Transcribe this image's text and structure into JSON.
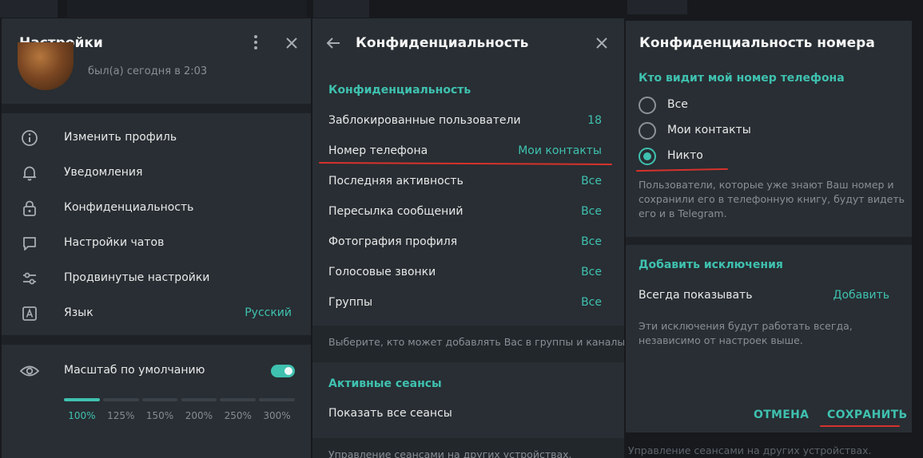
{
  "settings": {
    "title": "Настройки",
    "status": "был(а) сегодня в 2:03",
    "menu": [
      {
        "label": "Изменить профиль",
        "icon": "info-icon"
      },
      {
        "label": "Уведомления",
        "icon": "bell-icon"
      },
      {
        "label": "Конфиденциальность",
        "icon": "lock-icon"
      },
      {
        "label": "Настройки чатов",
        "icon": "chat-bubble-icon"
      },
      {
        "label": "Продвинутые настройки",
        "icon": "sliders-icon"
      },
      {
        "label": "Язык",
        "icon": "language-icon",
        "value": "Русский"
      }
    ],
    "scale": {
      "label": "Масштаб по умолчанию",
      "enabled": true,
      "options": [
        "100%",
        "125%",
        "150%",
        "200%",
        "250%",
        "300%"
      ],
      "selected_index": 0
    }
  },
  "privacy": {
    "title": "Конфиденциальность",
    "section_title": "Конфиденциальность",
    "rows": [
      {
        "label": "Заблокированные пользователи",
        "value": "18"
      },
      {
        "label": "Номер телефона",
        "value": "Мои контакты"
      },
      {
        "label": "Последняя активность",
        "value": "Все"
      },
      {
        "label": "Пересылка сообщений",
        "value": "Все"
      },
      {
        "label": "Фотография профиля",
        "value": "Все"
      },
      {
        "label": "Голосовые звонки",
        "value": "Все"
      },
      {
        "label": "Группы",
        "value": "Все"
      }
    ],
    "groups_hint": "Выберите, кто может добавлять Вас в группы и каналы.",
    "sessions_title": "Активные сеансы",
    "sessions_row": "Показать все сеансы",
    "sessions_hint": "Управление сеансами на других устройствах."
  },
  "phone_privacy": {
    "title": "Конфиденциальность номера",
    "section_title": "Кто видит мой номер телефона",
    "options": [
      "Все",
      "Мои контакты",
      "Никто"
    ],
    "selected_index": 2,
    "hint_lines": [
      "Пользователи, которые уже знают Ваш номер и",
      "сохранили его в телефонную книгу, будут видеть",
      "его и в Telegram."
    ],
    "exceptions_title": "Добавить исключения",
    "always_show_label": "Всегда показывать",
    "add_label": "Добавить",
    "exceptions_hint_lines": [
      "Эти исключения будут работать всегда,",
      "независимо от настроек выше."
    ],
    "cancel_label": "ОТМЕНА",
    "save_label": "СОХРАНИТЬ"
  },
  "background": {
    "sessions_hint": "Управление сеансами на других устройствах."
  },
  "colors": {
    "accent": "#3fc1b0",
    "panel": "#282e33",
    "annotation": "#d6322c"
  }
}
